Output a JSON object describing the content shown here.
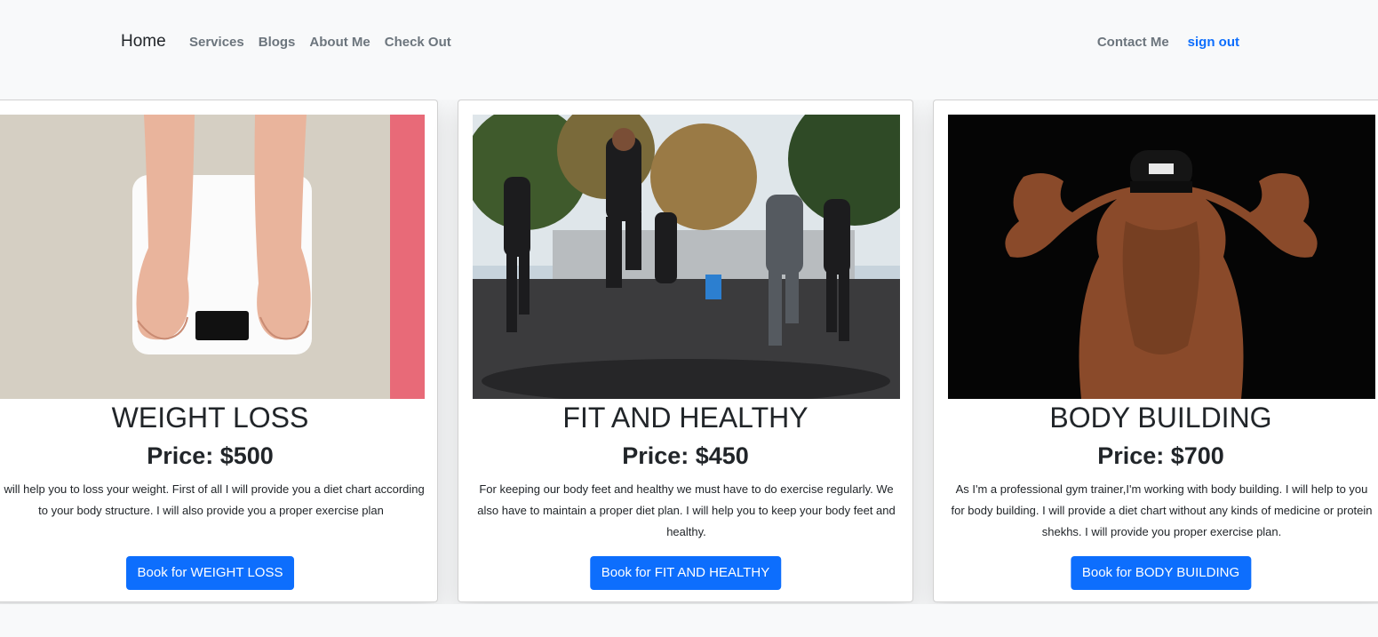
{
  "navbar": {
    "brand": "Home",
    "left_links": [
      "Services",
      "Blogs",
      "About Me",
      "Check Out"
    ],
    "contact": "Contact Me",
    "signout": "sign out"
  },
  "cards": [
    {
      "title": "WEIGHT LOSS",
      "price": "Price: $500",
      "description": "I will help you to loss your weight. First of all I will provide you a diet chart according to your body structure. I will also provide you a proper exercise plan",
      "button": "Book for WEIGHT LOSS"
    },
    {
      "title": "FIT AND HEALTHY",
      "price": "Price: $450",
      "description": "For keeping our body feet and healthy we must have to do exercise regularly. We also have to maintain a proper diet plan. I will help you to keep your body feet and healthy.",
      "button": "Book for FIT AND HEALTHY"
    },
    {
      "title": "BODY BUILDING",
      "price": "Price: $700",
      "description": "As I'm a professional gym trainer,I'm working with body building. I will help to you for body building. I will provide a diet chart without any kinds of medicine or protein shekhs. I will provide you proper exercise plan.",
      "button": "Book for BODY BUILDING"
    }
  ],
  "colors": {
    "primary": "#0d6efd",
    "nav_link": "#6c757d",
    "background": "#f8f9fa"
  }
}
